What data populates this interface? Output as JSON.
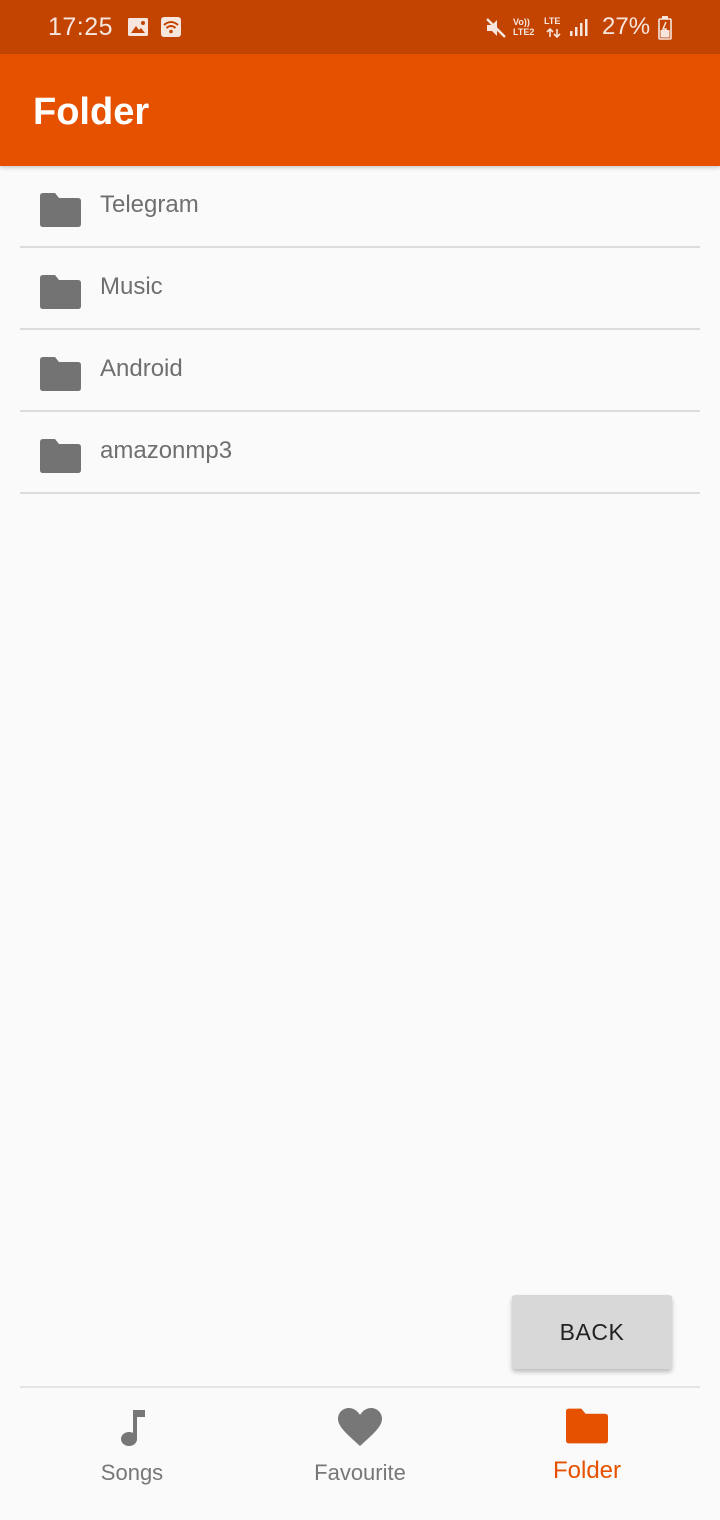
{
  "status_bar": {
    "time": "17:25",
    "battery_percent": "27%",
    "volte_label": "Vo)) LTE2",
    "lte_label": "LTE",
    "background_color": "#c34400"
  },
  "app_bar": {
    "title": "Folder",
    "background_color": "#e65100"
  },
  "folders": [
    {
      "name": "Telegram",
      "icon": "folder-icon"
    },
    {
      "name": "Music",
      "icon": "folder-icon"
    },
    {
      "name": "Android",
      "icon": "folder-icon"
    },
    {
      "name": "amazonmp3",
      "icon": "folder-icon"
    }
  ],
  "back_button": {
    "label": "BACK"
  },
  "bottom_nav": {
    "items": [
      {
        "label": "Songs",
        "icon": "music-note-icon",
        "active": false
      },
      {
        "label": "Favourite",
        "icon": "heart-icon",
        "active": false
      },
      {
        "label": "Folder",
        "icon": "folder-icon",
        "active": true
      }
    ],
    "active_color": "#e65100",
    "inactive_color": "#777777"
  }
}
